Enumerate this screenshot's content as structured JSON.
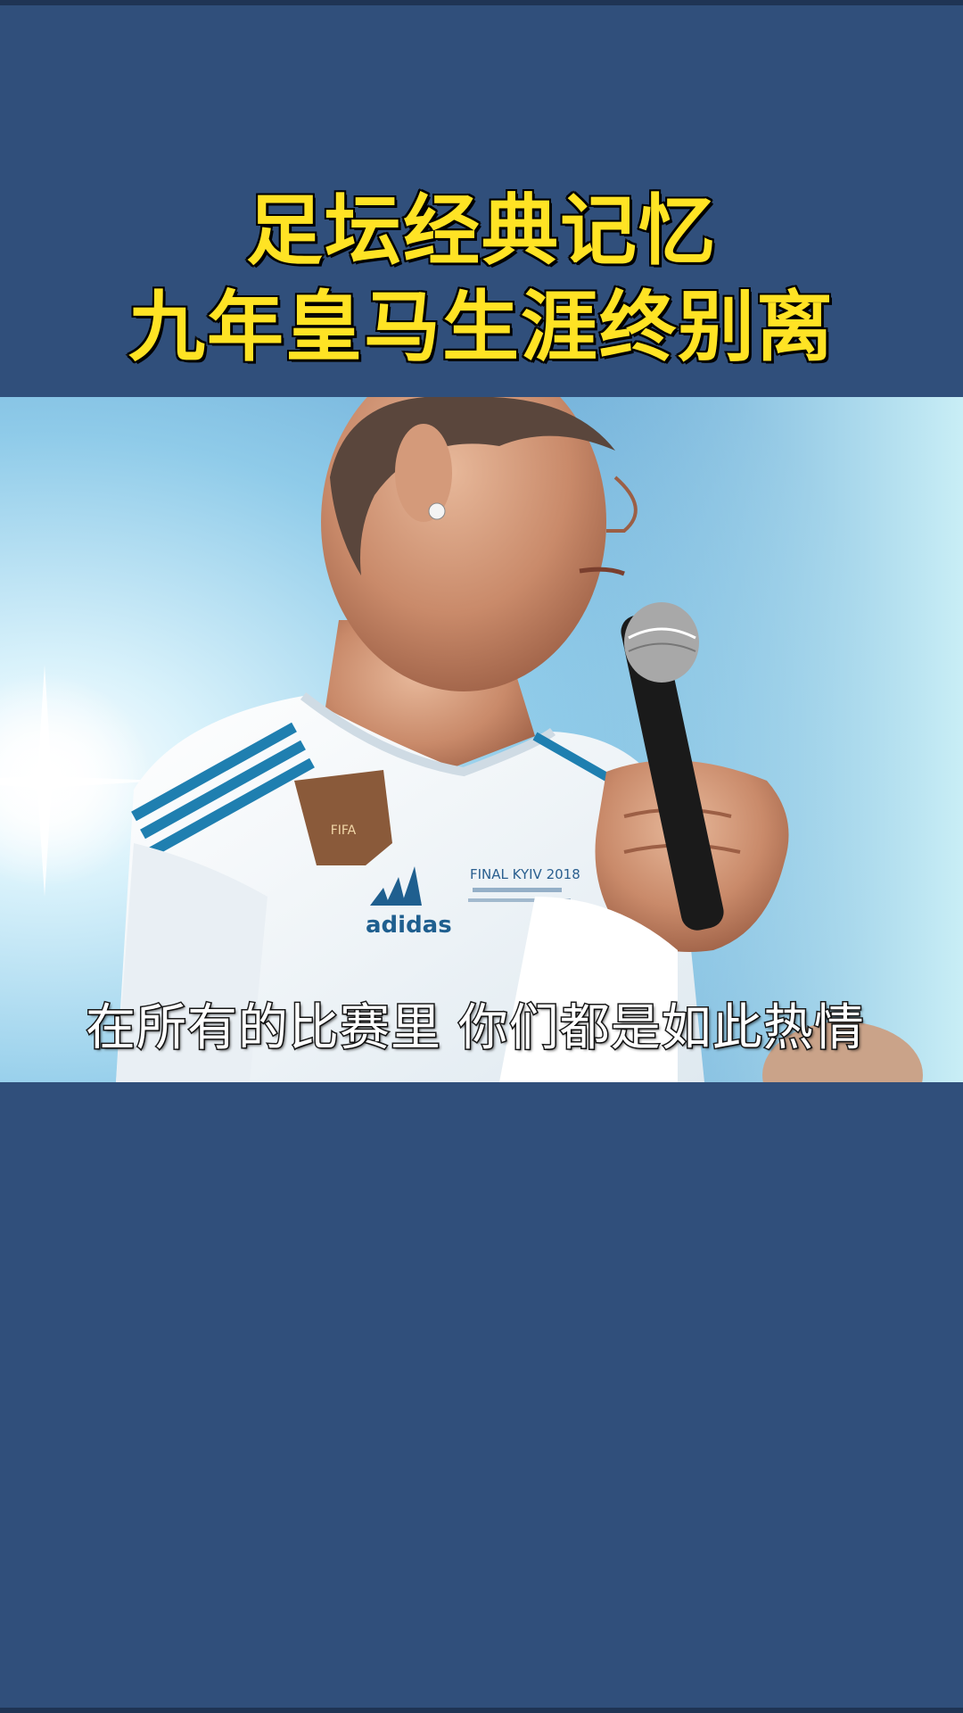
{
  "header": {
    "title_line1": "足坛经典记忆",
    "title_line2": "九年皇马生涯终别离"
  },
  "video": {
    "subtitle": "在所有的比赛里 你们都是如此热情",
    "jersey_text": "FINAL KYIV 2018",
    "brand_text": "adidas",
    "badge_text": "FIFA"
  },
  "colors": {
    "background": "#304f7b",
    "title": "#ffe324",
    "subtitle": "#ffffff"
  }
}
